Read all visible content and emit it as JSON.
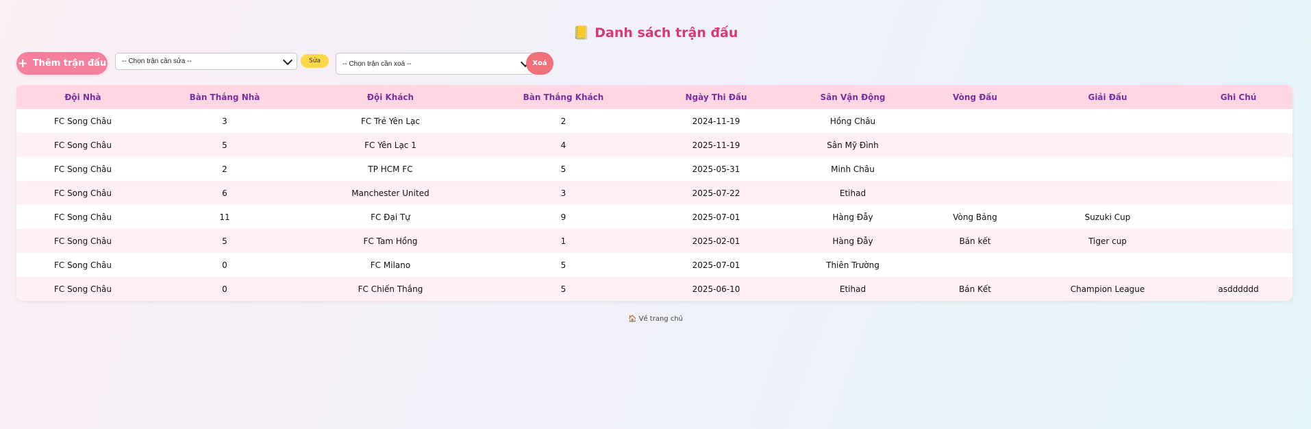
{
  "page": {
    "title": "Danh sách trận đấu",
    "title_icon": "📒"
  },
  "toolbar": {
    "add_label": "Thêm trận đấu",
    "add_icon": "+",
    "edit_select_value": "-- Chọn trận cần sửa --",
    "edit_label": "Sửa",
    "delete_select_value": "-- Chọn trận cần xoá --",
    "delete_label": "Xoá"
  },
  "table": {
    "headers": [
      "Đội Nhà",
      "Bàn Thắng Nhà",
      "Đội Khách",
      "Bàn Thắng Khách",
      "Ngày Thi Đấu",
      "Sân Vận Động",
      "Vòng Đấu",
      "Giải Đấu",
      "Ghi Chú"
    ],
    "rows": [
      [
        "FC Song Châu",
        "3",
        "FC Trẻ Yên Lạc",
        "2",
        "2024-11-19",
        "Hồng Châu",
        "",
        "",
        ""
      ],
      [
        "FC Song Châu",
        "5",
        "FC Yên Lạc 1",
        "4",
        "2025-11-19",
        "Sân Mỹ Đình",
        "",
        "",
        ""
      ],
      [
        "FC Song Châu",
        "2",
        "TP HCM FC",
        "5",
        "2025-05-31",
        "Minh Châu",
        "",
        "",
        ""
      ],
      [
        "FC Song Châu",
        "6",
        "Manchester United",
        "3",
        "2025-07-22",
        "Etihad",
        "",
        "",
        ""
      ],
      [
        "FC Song Châu",
        "11",
        "FC Đại Tự",
        "9",
        "2025-07-01",
        "Hàng Đẫy",
        "Vòng Bảng",
        "Suzuki Cup",
        ""
      ],
      [
        "FC Song Châu",
        "5",
        "FC Tam Hồng",
        "1",
        "2025-02-01",
        "Hàng Đẫy",
        "Bán kết",
        "Tiger cup",
        ""
      ],
      [
        "FC Song Châu",
        "0",
        "FC Milano",
        "5",
        "2025-07-01",
        "Thiên Trường",
        "",
        "",
        ""
      ],
      [
        "FC Song Châu",
        "0",
        "FC Chiến Thắng",
        "5",
        "2025-06-10",
        "Etihad",
        "Bán Kết",
        "Champion League",
        "asdddddd"
      ]
    ]
  },
  "footer": {
    "home_icon": "🏠",
    "home_label": "Về trang chủ"
  },
  "colors": {
    "title": "#d63a72",
    "add_button": "#f57f9f",
    "edit_button": "#ffd84a",
    "delete_button": "#f0707a",
    "header_bg": "#ffd6e2",
    "header_text": "#7a2fa0",
    "stripe": "#fff0f5"
  }
}
